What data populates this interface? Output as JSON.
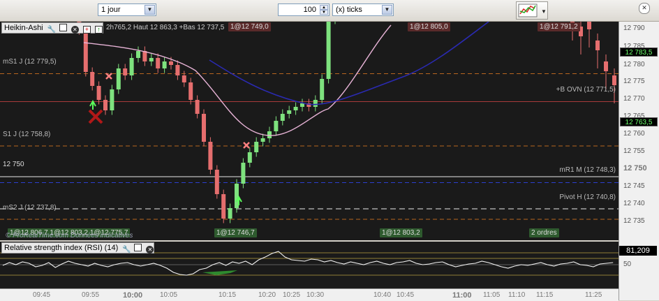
{
  "toolbar": {
    "period_value": "1 jour",
    "units_value": "100",
    "units_type": "(x) ticks"
  },
  "main_panel": {
    "title": "Heikin-Ashi",
    "info": "2h765,2 Haut 12 863,3 +Bas 12 737,5",
    "orders_top": [
      "1@12 749,0",
      "1@12 805,0",
      "1@12 791,2"
    ],
    "orders_bottom": [
      "1@12 806,7 1@12 803,2 1@12 775,7",
      "1@12 746,7",
      "1@12 803,2",
      "2 ordres"
    ],
    "levels": [
      {
        "label": "mS1 J (12 779,5)",
        "price": 12779.5,
        "style": "dash-orange"
      },
      {
        "label": "+B OVN (12 771,5)",
        "price": 12771.5,
        "style": "solid-red"
      },
      {
        "label": "S1 J (12 758,8)",
        "price": 12758.8,
        "style": "dash-orange"
      },
      {
        "label": "12 750",
        "price": 12750,
        "style": "solid-white"
      },
      {
        "label": "mR1 M (12 748,3)",
        "price": 12748.3,
        "style": "dash-blue"
      },
      {
        "label": "Pivot H (12 740,8)",
        "price": 12740.8,
        "style": "dash-white"
      },
      {
        "label": "mS2 J (12 737,8)",
        "price": 12737.8,
        "style": "dash-orange"
      }
    ],
    "watermark": "© ProRealTime.com Données indicatives"
  },
  "price_axis": {
    "ticks": [
      "12 790",
      "12 785",
      "12 780",
      "12 775",
      "12 770",
      "12 765",
      "12 760",
      "12 755",
      "12 750",
      "12 745",
      "12 740",
      "12 735"
    ],
    "tag_high": "12 783,5",
    "tag_low": "12 763,5"
  },
  "rsi_panel": {
    "title": "Relative strength index (RSI) (14)",
    "value": "81,209",
    "level_label": "50"
  },
  "time_axis": [
    "09:45",
    "09:55",
    "10:00",
    "10:05",
    "10:15",
    "10:20",
    "10:25",
    "10:30",
    "10:40",
    "10:45",
    "11:00",
    "11:05",
    "11:10",
    "11:15",
    "11:25"
  ],
  "colors": {
    "bull": "#7ee27e",
    "bear": "#e56e6e",
    "ma_fast": "#e7b3d6",
    "ma_slow": "#2a2ab0"
  }
}
